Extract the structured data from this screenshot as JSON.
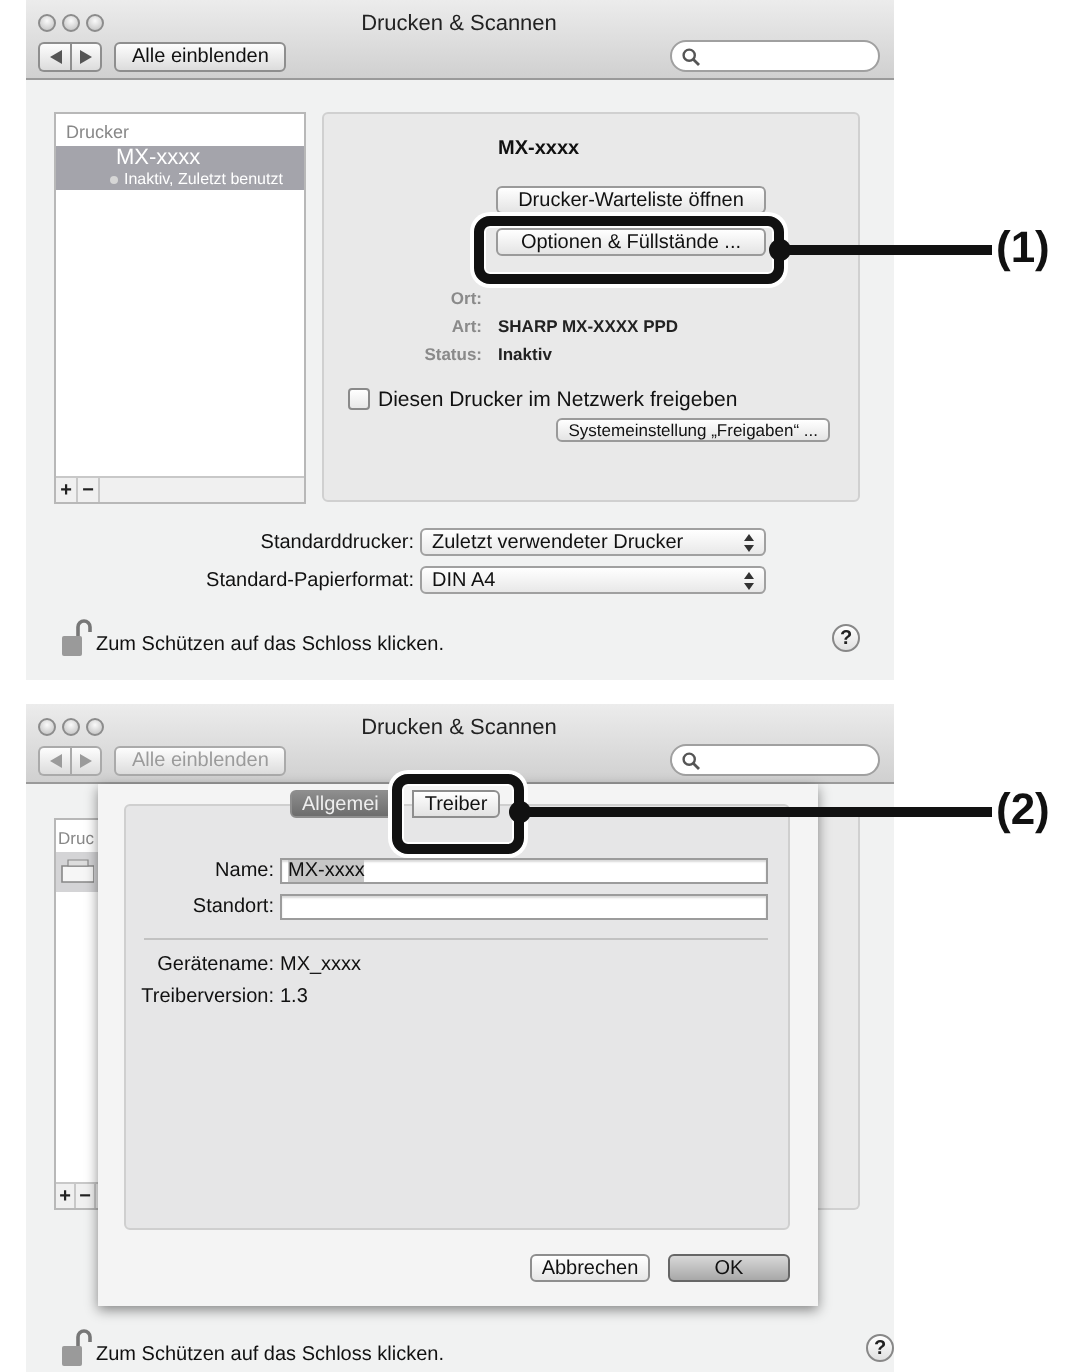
{
  "windows": [
    {
      "kind": "printers",
      "title": "Drucken & Scannen",
      "show_all_button": "Alle einblenden",
      "toolbar_disabled": false,
      "printer_list": {
        "header": "Drucker",
        "items": [
          {
            "name": "MX-xxxx",
            "status": "Inaktiv, Zuletzt benutzt",
            "selected": true
          }
        ],
        "buttons": [
          "+",
          "−"
        ]
      },
      "details": {
        "name": "MX-xxxx",
        "buttons": [
          "Drucker-Warteliste öffnen",
          "Optionen & Füllstände ..."
        ],
        "info": [
          {
            "label": "Ort:"
          },
          {
            "label": "Art:",
            "value": "SHARP MX-XXXX PPD"
          },
          {
            "label": "Status:",
            "value": "Inaktiv"
          }
        ],
        "share_checkbox": {
          "label": "Diesen Drucker im Netzwerk freigeben",
          "checked": false
        },
        "sharing_button": "Systemeinstellung „Freigaben“ ..."
      },
      "defaults": [
        {
          "label": "Standarddrucker:",
          "value": "Zuletzt verwendeter Drucker"
        },
        {
          "label": "Standard-Papierformat:",
          "value": "DIN A4"
        }
      ],
      "lock_text": "Zum Schützen auf das Schloss klicken.",
      "help": "?"
    },
    {
      "kind": "driver_sheet",
      "title": "Drucken & Scannen",
      "show_all_button": "Alle einblenden",
      "toolbar_disabled": true,
      "printer_list": {
        "header": "Druc",
        "buttons": [
          "+",
          "−"
        ]
      },
      "tabs": [
        {
          "label": "Allgemei",
          "selected": true
        },
        {
          "label": "Treiber",
          "selected": false
        }
      ],
      "fields": [
        {
          "label": "Name:",
          "value": "MX-xxxx",
          "text_selected": true
        },
        {
          "label": "Standort:"
        }
      ],
      "info": [
        {
          "label": "Gerätename:",
          "value": "MX_xxxx"
        },
        {
          "label": "Treiberversion:",
          "value": "1.3"
        }
      ],
      "buttons": [
        {
          "label": "Abbrechen",
          "default": false
        },
        {
          "label": "OK",
          "default": true
        }
      ],
      "lock_text": "Zum Schützen auf das Schloss klicken.",
      "help": "?"
    }
  ],
  "callouts": [
    {
      "label": "(1)"
    },
    {
      "label": "(2)"
    }
  ]
}
